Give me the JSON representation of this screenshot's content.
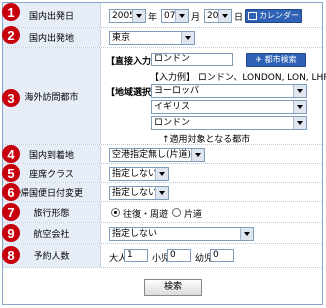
{
  "rows": {
    "departure_date": {
      "badge": "1",
      "label": "国内出発日",
      "year": "2005",
      "year_unit": "年",
      "month": "07",
      "month_unit": "月",
      "day": "20",
      "day_unit": "日",
      "calendar_button": "カレンダー"
    },
    "departure_place": {
      "badge": "2",
      "label": "国内出発地",
      "value": "東京"
    },
    "destination": {
      "badge": "3",
      "label": "海外訪問都市",
      "direct_label": "【直接入力】",
      "direct_value": "ロンドン",
      "city_search_button": "都市検索",
      "input_example": "【入力例】 ロンドン、LONDON, LON, LHR",
      "region_label": "【地域選択】",
      "region_value": "ヨーロッパ",
      "country_value": "イギリス",
      "city_value": "ロンドン",
      "note": "↑適用対象となる都市"
    },
    "arrival_place": {
      "badge": "4",
      "label": "国内到着地",
      "value": "空港指定無し(片道)"
    },
    "seat_class": {
      "badge": "5",
      "label": "座席クラス",
      "value": "指定しない"
    },
    "return_date_change": {
      "badge": "6",
      "label": "帰国便日付変更",
      "value": "指定しない"
    },
    "trip_type": {
      "badge": "7",
      "label": "旅行形態",
      "option_round": "往復・周遊",
      "option_oneway": "片道",
      "selected": "往復・周遊"
    },
    "airline": {
      "badge": "9",
      "label": "航空会社",
      "value": "指定しない"
    },
    "passengers": {
      "badge": "8",
      "label": "予約人数",
      "adult_label": "大人",
      "adult_value": "1",
      "child_label": "小児",
      "child_value": "0",
      "infant_label": "幼児",
      "infant_value": "0"
    }
  },
  "search_button": "検索",
  "colors": {
    "badge": "#c7000b",
    "label_bg": "#e6edf7",
    "button_blue": "#2f62b4"
  }
}
